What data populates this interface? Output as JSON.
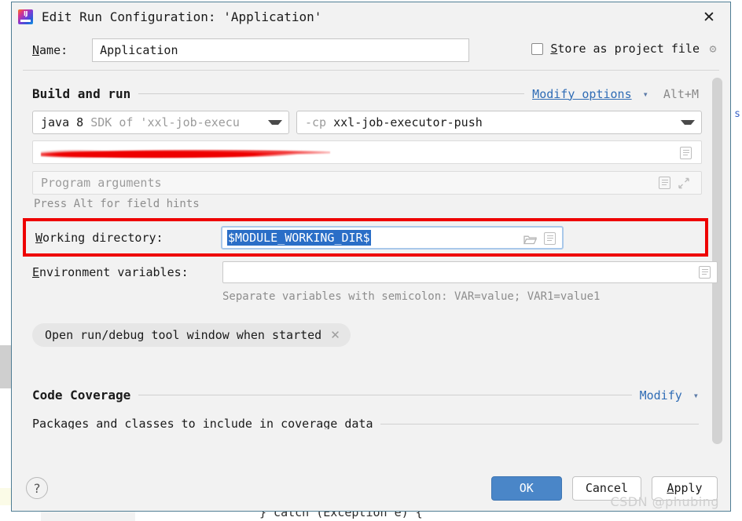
{
  "window": {
    "title": "Edit Run Configuration: 'Application'",
    "app_icon": "intellij-idea-logo-icon",
    "close_icon": "close-icon"
  },
  "name_row": {
    "label": "Name:",
    "label_mnemonic": "N",
    "value": "Application",
    "store_as_project_file": {
      "label": "Store as project file",
      "label_mnemonic": "S",
      "checked": false,
      "gear_icon": "gear-icon"
    }
  },
  "build_and_run": {
    "title": "Build and run",
    "modify_options_link": "Modify options",
    "modify_options_mnemonic": "M",
    "chevron_icon": "chevron-down-icon",
    "shortcut": "Alt+M",
    "sdk_combo": {
      "primary": "java 8",
      "secondary": "SDK of 'xxl-job-execu",
      "arrow_icon": "triangle-down-icon"
    },
    "classpath_combo": {
      "prefix": "-cp",
      "value": "xxl-job-executor-push",
      "arrow_icon": "triangle-down-icon"
    },
    "redacted_field": {
      "value": "",
      "redacted": true,
      "doc_icon": "document-icon"
    },
    "program_arguments": {
      "placeholder": "Program arguments",
      "value": "",
      "doc_icon": "document-icon",
      "expand_icon": "expand-icon"
    },
    "hint": "Press Alt for field hints"
  },
  "working_directory": {
    "label": "Working directory:",
    "label_mnemonic": "W",
    "value": "$MODULE_WORKING_DIR$",
    "selected": true,
    "folder_icon": "folder-icon",
    "doc_icon": "document-icon",
    "highlight_color": "#ee0000",
    "selection_color": "#2a6ec7"
  },
  "environment_variables": {
    "label": "Environment variables:",
    "label_mnemonic": "E",
    "value": "",
    "doc_icon": "document-icon",
    "hint": "Separate variables with semicolon: VAR=value; VAR1=value1"
  },
  "chip": {
    "label": "Open run/debug tool window when started",
    "close_icon": "close-icon"
  },
  "code_coverage": {
    "title": "Code Coverage",
    "modify_link": "Modify",
    "chevron_icon": "chevron-down-icon",
    "subsection": "Packages and classes to include in coverage data"
  },
  "footer": {
    "help_icon": "help-icon",
    "help_label": "?",
    "ok": "OK",
    "cancel": "Cancel",
    "apply": "Apply",
    "apply_mnemonic": "A",
    "watermark": "CSDN @phubing",
    "ok_color": "#4a86c8"
  },
  "backdrop": {
    "code_line": "} catch (Exception e) {",
    "code_keyword": "catch",
    "right_glyph": "s"
  }
}
